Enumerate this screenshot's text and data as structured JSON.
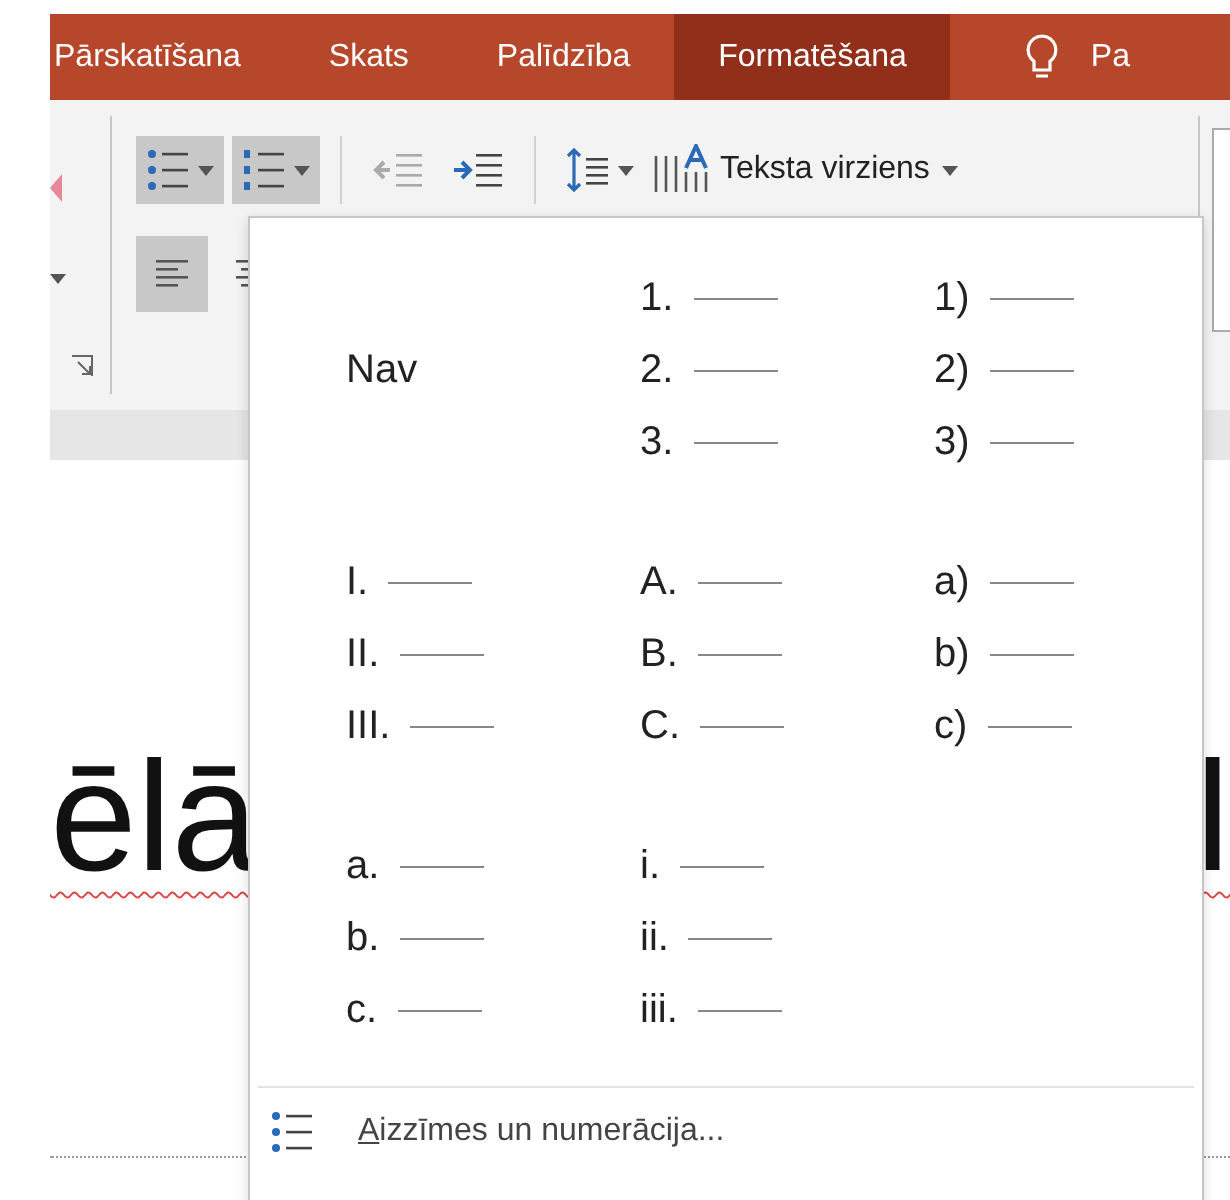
{
  "tabs": [
    {
      "label": "Pārskatīšana",
      "selected": false
    },
    {
      "label": "Skats",
      "selected": false
    },
    {
      "label": "Palīdzība",
      "selected": false
    },
    {
      "label": "Formatēšana",
      "selected": true
    }
  ],
  "tell_me": {
    "label": "Pa"
  },
  "toolbar": [
    {
      "kind": "bullets",
      "pressed": true,
      "disabled": false
    },
    {
      "kind": "numbering",
      "pressed": true,
      "disabled": false
    },
    {
      "kind": "outdent",
      "pressed": false,
      "disabled": true
    },
    {
      "kind": "indent",
      "pressed": false,
      "disabled": false
    },
    {
      "kind": "line_spacing",
      "pressed": false,
      "disabled": false
    }
  ],
  "text_direction": {
    "label": "Teksta virziens"
  },
  "align": [
    {
      "kind": "left",
      "selected": true
    },
    {
      "kind": "center",
      "selected": false
    }
  ],
  "numbering_menu": {
    "options": [
      {
        "kind": "none",
        "label": "Nav"
      },
      {
        "kind": "list",
        "markers": [
          "1.",
          "2.",
          "3."
        ]
      },
      {
        "kind": "list",
        "markers": [
          "1)",
          "2)",
          "3)"
        ]
      },
      {
        "kind": "list",
        "markers": [
          "I.",
          "II.",
          "III."
        ]
      },
      {
        "kind": "list",
        "markers": [
          "A.",
          "B.",
          "C."
        ]
      },
      {
        "kind": "list",
        "markers": [
          "a)",
          "b)",
          "c)"
        ]
      },
      {
        "kind": "list",
        "markers": [
          "a.",
          "b.",
          "c."
        ]
      },
      {
        "kind": "list",
        "markers": [
          "i.",
          "ii.",
          "iii."
        ]
      }
    ],
    "footer": {
      "access_key": "A",
      "label_rest": "izzīmes un numerācija..."
    }
  },
  "slide": {
    "title_fragments": [
      "ēlā",
      "l"
    ]
  }
}
